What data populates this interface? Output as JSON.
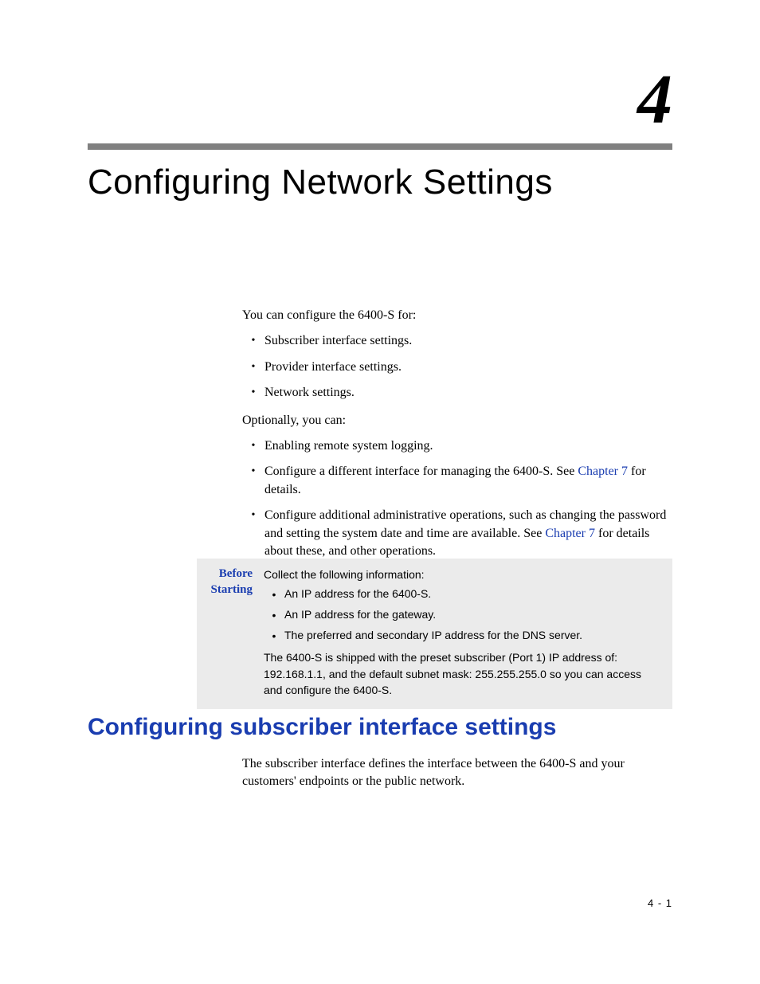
{
  "chapter": {
    "number": "4",
    "title": "Configuring Network Settings"
  },
  "intro": {
    "lead": "You can configure the 6400-S for:",
    "list1": {
      "item1": "Subscriber interface settings.",
      "item2": "Provider interface settings.",
      "item3": "Network settings."
    },
    "optional_lead": "Optionally, you can:",
    "list2": {
      "item1": "Enabling remote system logging.",
      "item2_pre": "Configure a different interface for managing the 6400-S. See ",
      "item2_link": "Chapter 7",
      "item2_post": " for details.",
      "item3_pre": "Configure additional administrative operations, such as changing the password and setting the system date and time are available. See ",
      "item3_link": "Chapter 7",
      "item3_post": " for details about these, and other operations."
    }
  },
  "before": {
    "label_line1": "Before",
    "label_line2": "Starting",
    "lead": "Collect the following information:",
    "items": {
      "a": "An IP address for the 6400-S.",
      "b": "An IP address for the gateway.",
      "c": "The preferred and secondary IP address for the DNS server."
    },
    "note": "The 6400-S is shipped with the preset subscriber (Port 1) IP address of: 192.168.1.1, and the default subnet mask: 255.255.255.0 so you can access and configure the 6400-S."
  },
  "section": {
    "heading": "Configuring subscriber interface settings",
    "body": "The subscriber interface defines the interface between the 6400-S and your customers' endpoints or the public network."
  },
  "footer": {
    "page": "4 - 1"
  }
}
